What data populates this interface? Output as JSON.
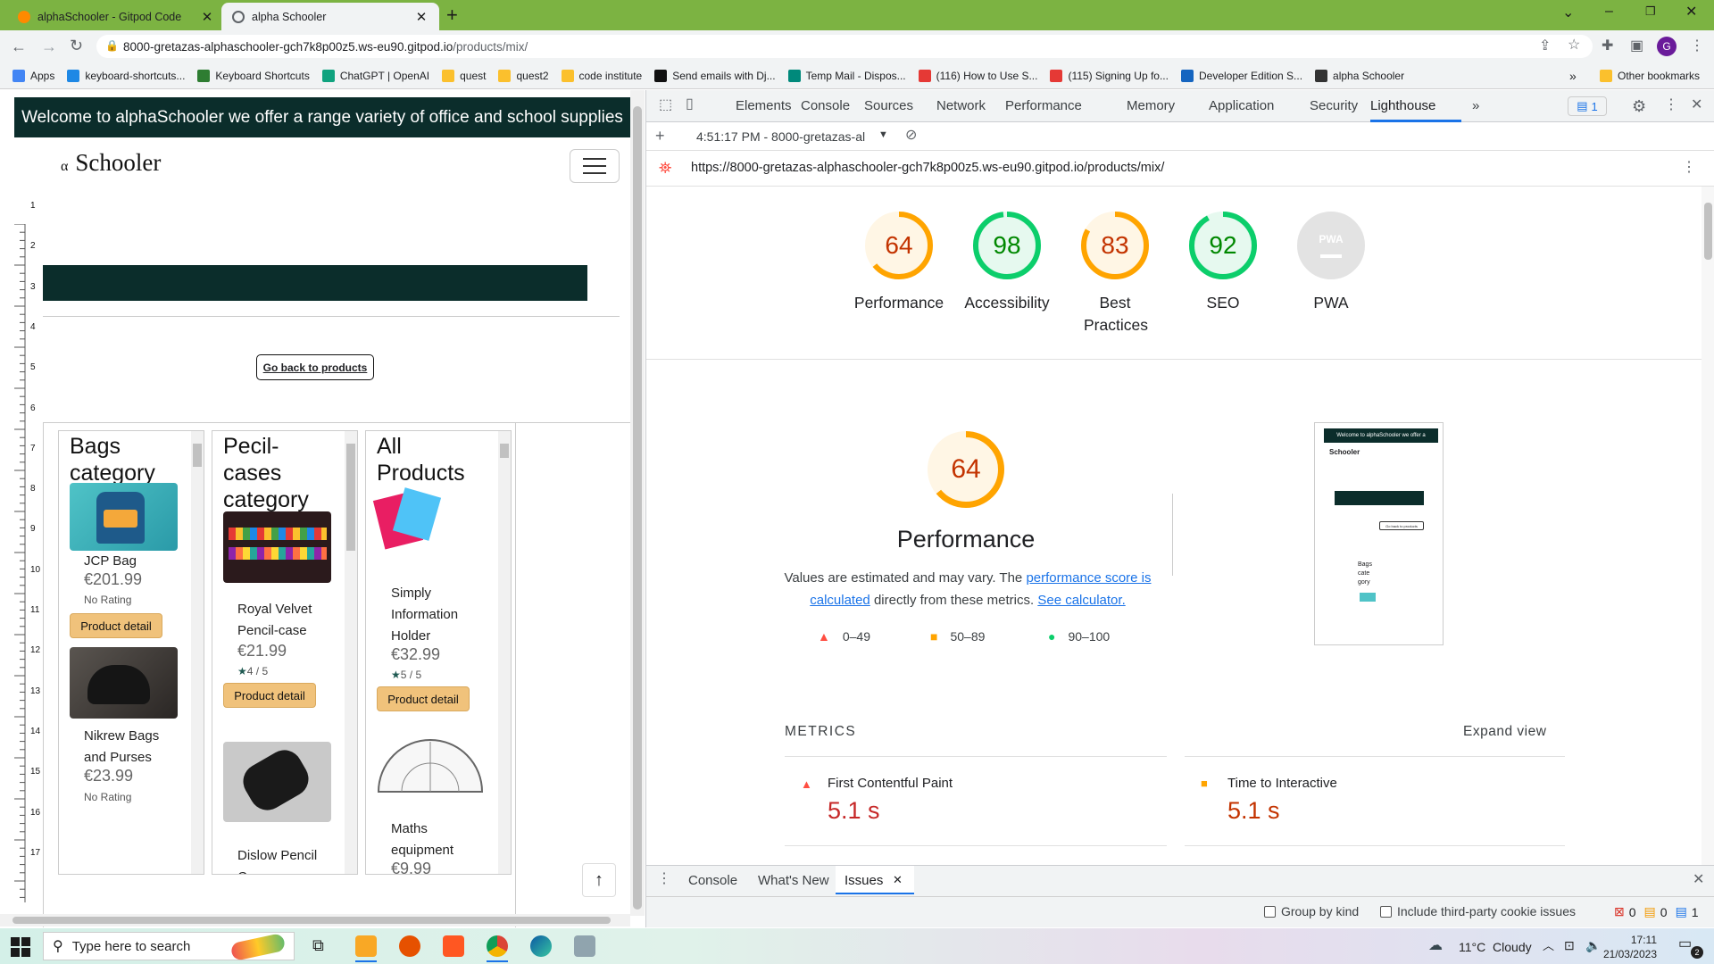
{
  "browser": {
    "tabs": [
      {
        "title": "alphaSchooler - Gitpod Code",
        "active": false
      },
      {
        "title": "alpha Schooler",
        "active": true
      }
    ],
    "url_host": "8000-gretazas-alphaschooler-gch7k8p00z5.ws-eu90.gitpod.io",
    "url_path": "/products/mix/",
    "bookmarks": [
      {
        "label": "Apps",
        "color": "#4285f4"
      },
      {
        "label": "keyboard-shortcuts...",
        "color": "#1e88e5"
      },
      {
        "label": "Keyboard Shortcuts",
        "color": "#2e7d32"
      },
      {
        "label": "ChatGPT | OpenAI",
        "color": "#10a37f"
      },
      {
        "label": "quest",
        "color": "#fbc02d"
      },
      {
        "label": "quest2",
        "color": "#fbc02d"
      },
      {
        "label": "code institute",
        "color": "#fbc02d"
      },
      {
        "label": "Send emails with Dj...",
        "color": "#111111"
      },
      {
        "label": "Temp Mail - Dispos...",
        "color": "#00897b"
      },
      {
        "label": "(116) How to Use S...",
        "color": "#e53935"
      },
      {
        "label": "(115) Signing Up fo...",
        "color": "#e53935"
      },
      {
        "label": "Developer Edition S...",
        "color": "#1565c0"
      },
      {
        "label": "alpha Schooler",
        "color": "#333333"
      }
    ],
    "other_bookmarks": "Other bookmarks",
    "more_bookmarks": "»",
    "profile_initial": "G"
  },
  "site": {
    "banner": "Welcome to alphaSchooler we offer a range variety of office and school supplies",
    "logo_alpha": "α",
    "logo_text": "Schooler",
    "back_button": "Go back to products",
    "ruler_numbers": [
      "1",
      "2",
      "3",
      "4",
      "5",
      "6",
      "7",
      "8",
      "9",
      "10",
      "11",
      "12",
      "13",
      "14",
      "15",
      "16",
      "17"
    ],
    "columns": [
      {
        "title": "Bags category",
        "products": [
          {
            "name": "JCP Bag",
            "price": "€201.99",
            "rating": "No Rating",
            "button": "Product detail"
          },
          {
            "name": "Nikrew Bags and Purses",
            "price": "€23.99",
            "rating": "No Rating"
          }
        ]
      },
      {
        "title": "Pecil-cases category",
        "products": [
          {
            "name": "Royal Velvet Pencil-case",
            "price": "€21.99",
            "rating": "4 / 5",
            "button": "Product detail"
          },
          {
            "name": "Dislow Pencil Case",
            "price": "",
            "rating": ""
          }
        ]
      },
      {
        "title": "All Products",
        "products": [
          {
            "name": "Simply Information Holder",
            "price": "€32.99",
            "rating": "5 / 5",
            "button": "Product detail"
          },
          {
            "name": "Maths equipment",
            "price": "€9.99",
            "rating": ""
          }
        ]
      }
    ],
    "to_top": "↑"
  },
  "devtools": {
    "tabs": [
      "Elements",
      "Console",
      "Sources",
      "Network",
      "Performance",
      "Memory",
      "Application",
      "Security",
      "Lighthouse"
    ],
    "active_tab": "Lighthouse",
    "more": "»",
    "issues_count": "1",
    "report_time": "4:51:17 PM - 8000-gretazas-al",
    "report_url": "https://8000-gretazas-alphaschooler-gch7k8p00z5.ws-eu90.gitpod.io/products/mix/",
    "scores": [
      {
        "label": "Performance",
        "value": 64,
        "status": "average"
      },
      {
        "label": "Accessibility",
        "value": 98,
        "status": "pass"
      },
      {
        "label": "Best Practices",
        "value": 83,
        "status": "average"
      },
      {
        "label": "SEO",
        "value": 92,
        "status": "pass"
      },
      {
        "label": "PWA",
        "value": null,
        "status": "na",
        "badge": "PWA"
      }
    ],
    "perf": {
      "score": 64,
      "title": "Performance",
      "desc1": "Values are estimated and may vary. The",
      "link1": "performance score is calculated",
      "desc2": "directly from these metrics.",
      "link2": "See calculator.",
      "legend": [
        "0–49",
        "50–89",
        "90–100"
      ]
    },
    "screenshot_thumb": {
      "banner": "Welcome to alphaSchooler we offer a",
      "logo": "Schooler",
      "back": "Go back to products",
      "col_title": "Bags cate gory"
    },
    "metrics_label": "METRICS",
    "expand_view": "Expand view",
    "metrics": [
      {
        "name": "First Contentful Paint",
        "value": "5.1 s",
        "status": "fail"
      },
      {
        "name": "Time to Interactive",
        "value": "5.1 s",
        "status": "average"
      }
    ],
    "drawer": {
      "tabs": [
        "Console",
        "What's New",
        "Issues"
      ],
      "active": "Issues",
      "group_by_kind": "Group by kind",
      "third_party": "Include third-party cookie issues",
      "counts": {
        "errors": "0",
        "warnings": "0",
        "info": "1"
      }
    }
  },
  "taskbar": {
    "search_placeholder": "Type here to search",
    "weather": "11°C  Cloudy",
    "time": "17:11",
    "date": "21/03/2023",
    "notifications": "2"
  },
  "colors": {
    "tabstrip": "#7cb342",
    "banner": "#0b2d2b",
    "pass": "#0cce6b",
    "average": "#ffa400",
    "fail": "#ff4e42",
    "button": "#f0c27b"
  }
}
